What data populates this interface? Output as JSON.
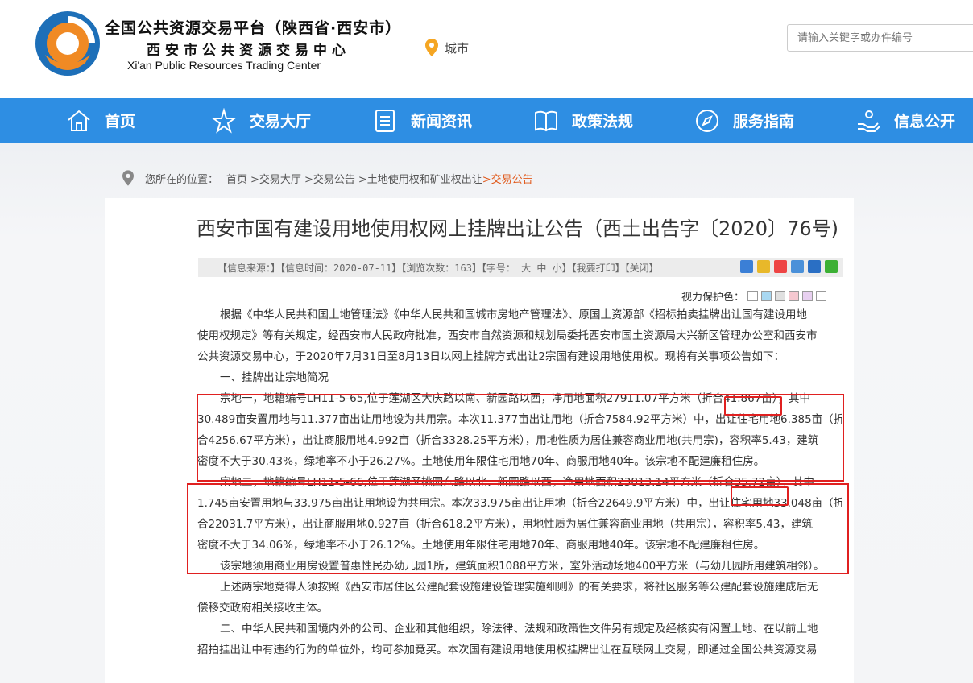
{
  "header": {
    "title_cn": "全国公共资源交易平台（陕西省·西安市）",
    "title_sub": "西安市公共资源交易中心",
    "title_en": "Xi'an Public Resources Trading Center",
    "city_label": "城市",
    "search_placeholder": "请输入关键字或办件编号"
  },
  "nav": [
    {
      "label": "首页",
      "icon": "home-icon"
    },
    {
      "label": "交易大厅",
      "icon": "star-icon"
    },
    {
      "label": "新闻资讯",
      "icon": "document-icon"
    },
    {
      "label": "政策法规",
      "icon": "book-icon"
    },
    {
      "label": "服务指南",
      "icon": "compass-icon"
    },
    {
      "label": "信息公开",
      "icon": "hand-icon"
    }
  ],
  "breadcrumb": {
    "prefix": "您所在的位置：",
    "items": [
      "首页",
      ">交易大厅",
      ">交易公告",
      ">土地使用权和矿业权出让",
      ">交易公告"
    ]
  },
  "article": {
    "title": "西安市国有建设用地使用权网上挂牌出让公告（西土出告字〔2020〕76号)",
    "info": "【信息来源：】【信息时间：2020-07-11】【浏览次数：163】【字号： 大 中 小】【我要打印】【关闭】",
    "eye_label": "视力保护色：",
    "eye_colors": [
      "#ffffff",
      "#a9d8f2",
      "#e0e0e0",
      "#f5c8d0",
      "#e8d0f0",
      "#ffffff"
    ],
    "lines": [
      "根据《中华人民共和国土地管理法》《中华人民共和国城市房地产管理法》、原国土资源部《招标拍卖挂牌出让国有建设用地",
      "使用权规定》等有关规定，经西安市人民政府批准，西安市自然资源和规划局委托西安市国土资源局大兴新区管理办公室和西安市",
      "公共资源交易中心，于2020年7月31日至8月13日以网上挂牌方式出让2宗国有建设用地使用权。现将有关事项公告如下：",
      "一、挂牌出让宗地简况",
      "宗地一，地籍编号LH11-5-65,位于莲湖区大庆路以南、新园路以西，净用地面积27911.07平方米（折合41.867亩），其中",
      "30.489亩安置用地与11.377亩出让用地设为共用宗。本次11.377亩出让用地（折合7584.92平方米）中，出让住宅用地6.385亩（折",
      "合4256.67平方米），出让商服用地4.992亩（折合3328.25平方米），用地性质为居住兼容商业用地(共用宗)，容积率5.43，建筑",
      "密度不大于30.43%，绿地率不小于26.27%。土地使用年限住宅用地70年、商服用地40年。该宗地不配建廉租住房。",
      "宗地二，地籍编号LH11-5-66,位于莲湖区桃园东路以北、新园路以西，净用地面积23813.14平方米（折合35.72亩），其中",
      "1.745亩安置用地与33.975亩出让用地设为共用宗。本次33.975亩出让用地（折合22649.9平方米）中，出让住宅用地33.048亩（折",
      "合22031.7平方米），出让商服用地0.927亩（折合618.2平方米），用地性质为居住兼容商业用地（共用宗），容积率5.43，建筑",
      "密度不大于34.06%，绿地率不小于26.12%。土地使用年限住宅用地70年、商服用地40年。该宗地不配建廉租住房。",
      "该宗地须用商业用房设置普惠性民办幼儿园1所，建筑面积1088平方米，室外活动场地400平方米（与幼儿园所用建筑相邻）。",
      "上述两宗地竞得人须按照《西安市居住区公建配套设施建设管理实施细则》的有关要求，将社区服务等公建配套设施建成后无",
      "偿移交政府相关接收主体。",
      "二、中华人民共和国境内外的公司、企业和其他组织，除法律、法规和政策性文件另有规定及经核实有闲置土地、在以前土地",
      "招拍挂出让中有违约行为的单位外，均可参加竞买。本次国有建设用地使用权挂牌出让在互联网上交易，即通过全国公共资源交易"
    ]
  }
}
